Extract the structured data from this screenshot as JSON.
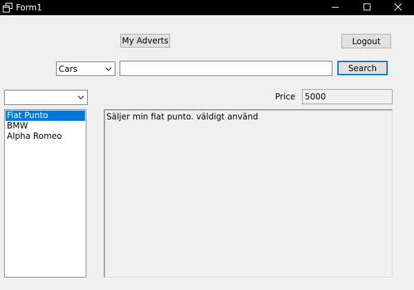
{
  "window": {
    "title": "Form1",
    "icon": "window-app-icon"
  },
  "toolbar": {
    "my_adverts_label": "My Adverts",
    "logout_label": "Logout",
    "search_label": "Search"
  },
  "search": {
    "category_selected": "Cars",
    "query_value": ""
  },
  "filter": {
    "selected": ""
  },
  "price": {
    "label": "Price",
    "value": "5000"
  },
  "adverts": {
    "items": [
      {
        "label": "Fiat Punto",
        "selected": true
      },
      {
        "label": "BMW",
        "selected": false
      },
      {
        "label": "Alpha Romeo",
        "selected": false
      }
    ]
  },
  "description": {
    "text": "Säljer min fiat punto. väldigt använd"
  },
  "colors": {
    "titlebar": "#000000",
    "selection": "#0078d7",
    "window_bg": "#f0f0f0"
  }
}
